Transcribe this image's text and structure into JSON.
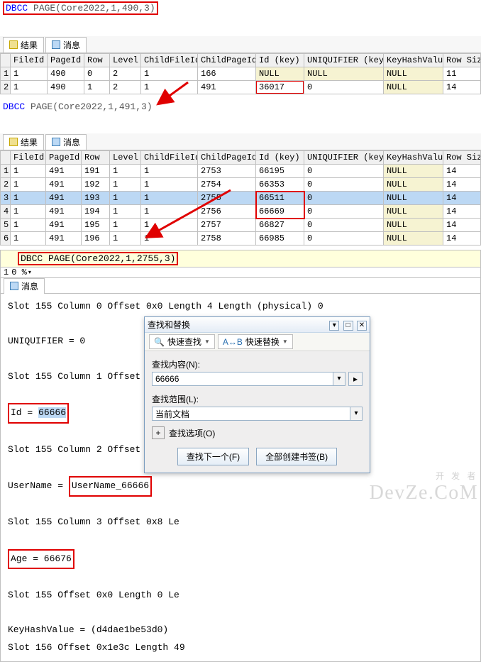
{
  "query1": {
    "prefix": "DBCC",
    "rest": " PAGE(Core2022,1,490,3)"
  },
  "query2": {
    "prefix": "DBCC",
    "rest": " PAGE(Core2022,1,491,3)"
  },
  "query3": {
    "full": "DBCC PAGE(Core2022,1,2755,3)"
  },
  "tabs": {
    "results": "结果",
    "messages": "消息"
  },
  "cols": [
    "FileId",
    "PageId",
    "Row",
    "Level",
    "ChildFileId",
    "ChildPageId",
    "Id (key)",
    "UNIQUIFIER (key)",
    "KeyHashValue",
    "Row Size"
  ],
  "table1": [
    {
      "FileId": "1",
      "PageId": "490",
      "Row": "0",
      "Level": "2",
      "ChildFileId": "1",
      "ChildPageId": "166",
      "IdKey": "NULL",
      "UniqKey": "NULL",
      "KeyHash": "NULL",
      "RowSize": "11"
    },
    {
      "FileId": "1",
      "PageId": "490",
      "Row": "1",
      "Level": "2",
      "ChildFileId": "1",
      "ChildPageId": "491",
      "IdKey": "36017",
      "UniqKey": "0",
      "KeyHash": "NULL",
      "RowSize": "14"
    }
  ],
  "table2": [
    {
      "FileId": "1",
      "PageId": "491",
      "Row": "191",
      "Level": "1",
      "ChildFileId": "1",
      "ChildPageId": "2753",
      "IdKey": "66195",
      "UniqKey": "0",
      "KeyHash": "NULL",
      "RowSize": "14"
    },
    {
      "FileId": "1",
      "PageId": "491",
      "Row": "192",
      "Level": "1",
      "ChildFileId": "1",
      "ChildPageId": "2754",
      "IdKey": "66353",
      "UniqKey": "0",
      "KeyHash": "NULL",
      "RowSize": "14"
    },
    {
      "FileId": "1",
      "PageId": "491",
      "Row": "193",
      "Level": "1",
      "ChildFileId": "1",
      "ChildPageId": "2755",
      "IdKey": "66511",
      "UniqKey": "0",
      "KeyHash": "NULL",
      "RowSize": "14",
      "sel": true
    },
    {
      "FileId": "1",
      "PageId": "491",
      "Row": "194",
      "Level": "1",
      "ChildFileId": "1",
      "ChildPageId": "2756",
      "IdKey": "66669",
      "UniqKey": "0",
      "KeyHash": "NULL",
      "RowSize": "14"
    },
    {
      "FileId": "1",
      "PageId": "491",
      "Row": "195",
      "Level": "1",
      "ChildFileId": "1",
      "ChildPageId": "2757",
      "IdKey": "66827",
      "UniqKey": "0",
      "KeyHash": "NULL",
      "RowSize": "14"
    },
    {
      "FileId": "1",
      "PageId": "491",
      "Row": "196",
      "Level": "1",
      "ChildFileId": "1",
      "ChildPageId": "2758",
      "IdKey": "66985",
      "UniqKey": "0",
      "KeyHash": "NULL",
      "RowSize": "14"
    }
  ],
  "zoom": "0 %",
  "msgtab": "消息",
  "mono": {
    "l1": "Slot 155 Column 0 Offset 0x0 Length 4 Length (physical) 0",
    "l2": "UNIQUIFIER = 0",
    "l3": "Slot 155 Column 1 Offset 0x4 Le",
    "l4a": "Id = ",
    "l4b": "66666",
    "l5": "Slot 155 Column 2 Offset 0x15 L",
    "l6a": "UserName = ",
    "l6b": "UserName_66666",
    "l7": "Slot 155 Column 3 Offset 0x8 Le",
    "l8": "Age = 66676",
    "l9": "Slot 155 Offset 0x0 Length 0 Le",
    "l10": "KeyHashValue = (d4dae1be53d0)",
    "l11": "Slot 156 Offset 0x1e3c Length 49"
  },
  "dialog": {
    "title": "查找和替换",
    "quickFind": "快速查找",
    "quickReplace": "快速替换",
    "findContent": "查找内容(N):",
    "findValue": "66666",
    "scopeLabel": "查找范围(L):",
    "scopeValue": "当前文档",
    "options": "查找选项(O)",
    "findNext": "查找下一个(F)",
    "bookmark": "全部创建书签(B)"
  },
  "watermark": {
    "top": "开 发 者",
    "bottom": "DevZe.CoM"
  },
  "chart_data": null
}
